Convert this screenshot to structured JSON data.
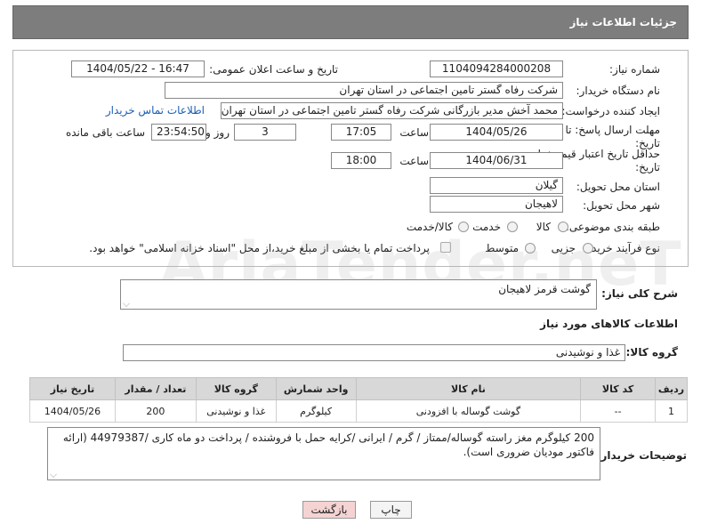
{
  "header": {
    "title": "جزئیات اطلاعات نیاز"
  },
  "form": {
    "need_number": {
      "label": "شماره نیاز:",
      "value": "1104094284000208"
    },
    "announce_datetime": {
      "label": "تاریخ و ساعت اعلان عمومی:",
      "value": "1404/05/22 - 16:47"
    },
    "buyer_org": {
      "label": "نام دستگاه خریدار:",
      "value": "شرکت رفاه گستر تامین اجتماعی در استان تهران"
    },
    "requester": {
      "label": "ایجاد کننده درخواست:",
      "value": "محمد آخش مدیر بازرگانی شرکت رفاه گستر تامین اجتماعی در استان تهران",
      "contact_link": "اطلاعات تماس خریدار"
    },
    "response_deadline": {
      "label": "مهلت ارسال پاسخ: تا تاریخ:",
      "date": "1404/05/26",
      "time_label": "ساعت",
      "time": "17:05",
      "days": "3",
      "days_label": "روز و",
      "remaining": "23:54:50",
      "remaining_label": "ساعت باقی مانده"
    },
    "price_validity": {
      "label": "حداقل تاریخ اعتبار قیمت: تا تاریخ:",
      "date": "1404/06/31",
      "time_label": "ساعت",
      "time": "18:00"
    },
    "delivery_province": {
      "label": "استان محل تحویل:",
      "value": "گیلان"
    },
    "delivery_city": {
      "label": "شهر محل تحویل:",
      "value": "لاهیجان"
    },
    "category": {
      "label": "طبقه بندی موضوعی:",
      "options": [
        "کالا",
        "خدمت",
        "کالا/خدمت"
      ],
      "selected": "کالا"
    },
    "purchase_type": {
      "label": "نوع فرآیند خرید :",
      "options": [
        "جزیی",
        "متوسط"
      ],
      "payment_note": "پرداخت تمام یا بخشی از مبلغ خرید،از محل \"اسناد خزانه اسلامی\" خواهد بود."
    }
  },
  "description": {
    "label": "شرح کلی نیاز:",
    "value": "گوشت قرمز لاهیجان"
  },
  "goods_info": {
    "title": "اطلاعات کالاهای مورد نیاز",
    "group_label": "گروه کالا:",
    "group_value": "غذا و نوشیدنی"
  },
  "table": {
    "headers": [
      "ردیف",
      "کد کالا",
      "نام کالا",
      "واحد شمارش",
      "گروه کالا",
      "تعداد / مقدار",
      "تاریخ نیاز"
    ],
    "rows": [
      {
        "row": "1",
        "code": "--",
        "name": "گوشت گوساله با افزودنی",
        "unit": "کیلوگرم",
        "group": "غذا و نوشیدنی",
        "qty": "200",
        "date": "1404/05/26"
      }
    ]
  },
  "buyer_notes": {
    "label": "توضیحات خریدار:",
    "value": "200 کیلوگرم مغز راسته گوساله/ممتاز / گرم / ایرانی /کرایه حمل با فروشنده / پرداخت دو ماه کاری /44979387 (ارائه فاکتور مودیان ضروری است)."
  },
  "buttons": {
    "print": "چاپ",
    "back": "بازگشت"
  },
  "watermark": "AriaTender.neT",
  "colors": {
    "header_bg": "#7d7d7d",
    "link": "#1a5fb4",
    "back_button_bg": "#f5d3d3"
  }
}
